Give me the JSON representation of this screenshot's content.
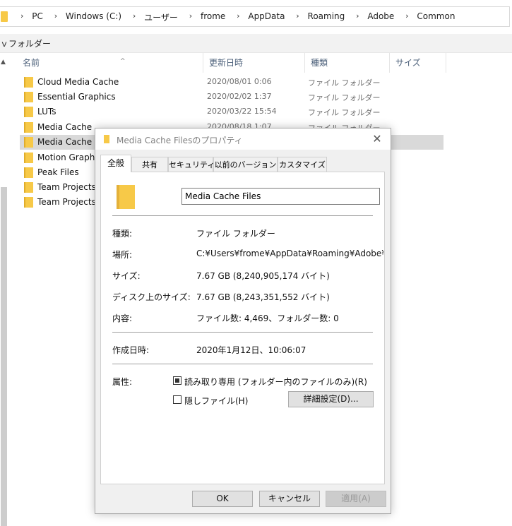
{
  "address_bar": {
    "crumbs": [
      "PC",
      "Windows (C:)",
      "ユーザー",
      "frome",
      "AppData",
      "Roaming",
      "Adobe",
      "Common"
    ],
    "separator": "›"
  },
  "nav_pane": {
    "label": "ｖフォルダー"
  },
  "columns": {
    "name": "名前",
    "date": "更新日時",
    "type": "種類",
    "size": "サイズ"
  },
  "files": [
    {
      "name": "Cloud Media Cache",
      "date": "2020/08/01 0:06",
      "type": "ファイル フォルダー"
    },
    {
      "name": "Essential Graphics",
      "date": "2020/02/02 1:37",
      "type": "ファイル フォルダー"
    },
    {
      "name": "LUTs",
      "date": "2020/03/22 15:54",
      "type": "ファイル フォルダー"
    },
    {
      "name": "Media Cache",
      "date": "2020/08/18 1:07",
      "type": "ファイル フォルダー"
    },
    {
      "name": "Media Cache Files",
      "date": "",
      "type": ""
    },
    {
      "name": "Motion Graphics",
      "date": "",
      "type": ""
    },
    {
      "name": "Peak Files",
      "date": "",
      "type": ""
    },
    {
      "name": "Team Projects C",
      "date": "",
      "type": ""
    },
    {
      "name": "Team Projects L",
      "date": "",
      "type": ""
    }
  ],
  "dialog": {
    "title": "Media Cache Filesのプロパティ",
    "tabs": [
      "全般",
      "共有",
      "セキュリティ",
      "以前のバージョン",
      "カスタマイズ"
    ],
    "folder_name": "Media Cache Files",
    "type_label": "種類:",
    "type_value": "ファイル フォルダー",
    "location_label": "場所:",
    "location_value": "C:¥Users¥frome¥AppData¥Roaming¥Adobe¥Common",
    "size_label": "サイズ:",
    "size_value": "7.67 GB (8,240,905,174 バイト)",
    "disk_size_label": "ディスク上のサイズ:",
    "disk_size_value": "7.67 GB (8,243,351,552 バイト)",
    "contents_label": "内容:",
    "contents_value": "ファイル数: 4,469、フォルダー数: 0",
    "created_label": "作成日時:",
    "created_value": "2020年1月12日、10:06:07",
    "attributes_label": "属性:",
    "readonly_label": "読み取り専用 (フォルダー内のファイルのみ)(R)",
    "hidden_label": "隠しファイル(H)",
    "advanced_button": "詳細設定(D)...",
    "ok_button": "OK",
    "cancel_button": "キャンセル",
    "apply_button": "適用(A)",
    "close_glyph": "✕"
  }
}
